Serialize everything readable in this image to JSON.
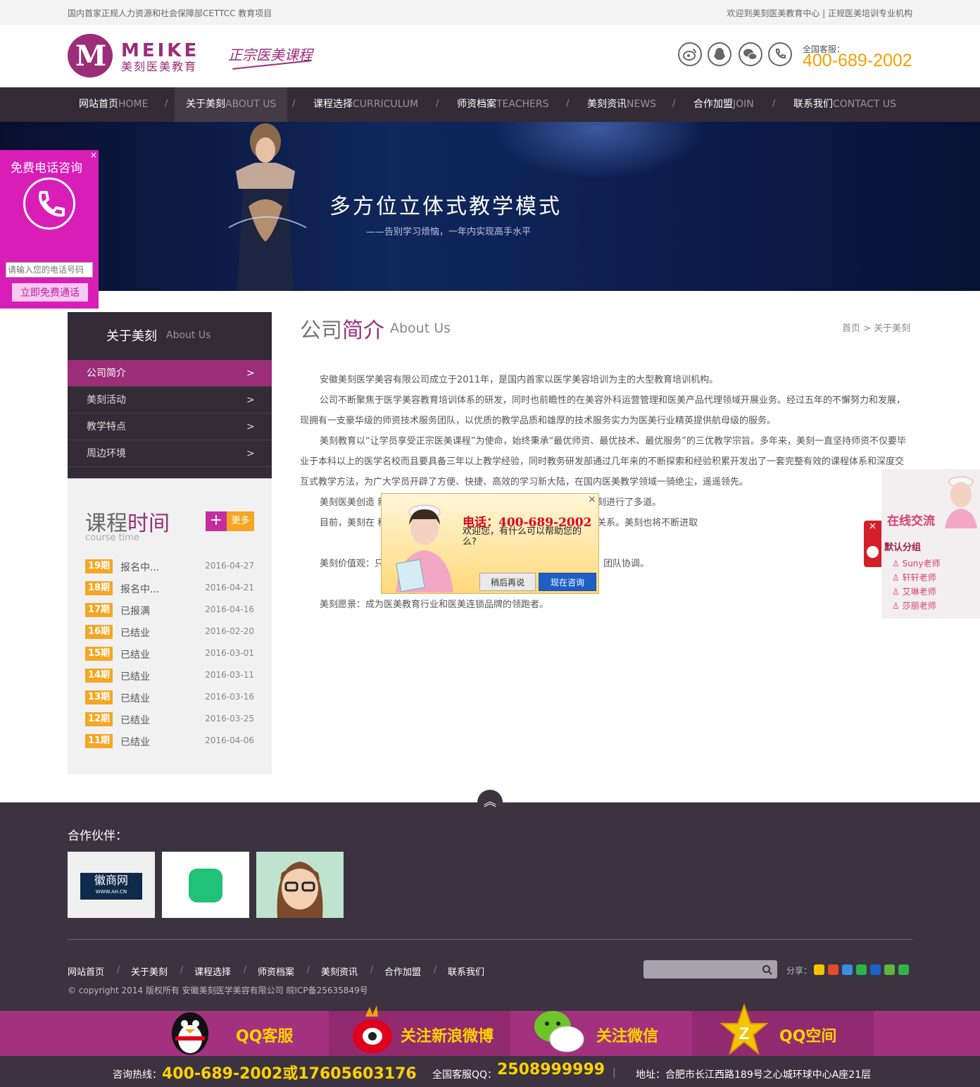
{
  "topbar": {
    "left": "国内首家正规人力资源和社会保障部CETTCC 教育项目",
    "right": "欢迎到美刻医美教育中心 | 正规医美培训专业机构"
  },
  "header": {
    "logo_mark": "M",
    "logo_en": "MEIKE",
    "logo_cn": "美刻医美教育",
    "slogan": "正宗医美课程",
    "service_label": "全国客服：",
    "service_phone": "400-689-2002"
  },
  "nav": [
    {
      "cn": "网站首页",
      "en": "HOME"
    },
    {
      "cn": "关于美刻",
      "en": "ABOUT US"
    },
    {
      "cn": "课程选择",
      "en": "CURRICULUM"
    },
    {
      "cn": "师资档案",
      "en": "TEACHERS"
    },
    {
      "cn": "美刻资讯",
      "en": "NEWS"
    },
    {
      "cn": "合作加盟",
      "en": "JOIN"
    },
    {
      "cn": "联系我们",
      "en": "CONTACT US"
    }
  ],
  "nav_separator": "/",
  "banner": {
    "title": "多方位立体式教学模式",
    "subtitle": "——告别学习烦恼，一年内实现高手水平"
  },
  "float_call": {
    "title": "免费电话咨询",
    "close": "×",
    "placeholder": "请输入您的电话号码",
    "button": "立即免费通话"
  },
  "sidebar": {
    "title": "关于美刻",
    "title_en": "About Us",
    "items": [
      {
        "label": "公司简介",
        "arrow": ">"
      },
      {
        "label": "美刻活动",
        "arrow": ">"
      },
      {
        "label": "教学特点",
        "arrow": ">"
      },
      {
        "label": "周边环境",
        "arrow": ">"
      }
    ],
    "course": {
      "title_a": "课程",
      "title_b": "时间",
      "subtitle": "course time",
      "plus": "+",
      "more": "更多",
      "rows": [
        {
          "term": "19期",
          "status": "报名中...",
          "date": "2016-04-27"
        },
        {
          "term": "18期",
          "status": "报名中...",
          "date": "2016-04-21"
        },
        {
          "term": "17期",
          "status": "已报满",
          "date": "2016-04-16"
        },
        {
          "term": "16期",
          "status": "已结业",
          "date": "2016-02-20"
        },
        {
          "term": "15期",
          "status": "已结业",
          "date": "2016-03-01"
        },
        {
          "term": "14期",
          "status": "已结业",
          "date": "2016-03-11"
        },
        {
          "term": "13期",
          "status": "已结业",
          "date": "2016-03-16"
        },
        {
          "term": "12期",
          "status": "已结业",
          "date": "2016-03-25"
        },
        {
          "term": "11期",
          "status": "已结业",
          "date": "2016-04-06"
        }
      ]
    }
  },
  "main": {
    "title_a": "公司",
    "title_b": "简介",
    "title_en": "About Us",
    "breadcrumb": "首页 > 关于美刻",
    "paragraphs": [
      "安徽美刻医学美容有限公司成立于2011年，是国内首家以医学美容培训为主的大型教育培训机构。",
      "公司不断聚焦于医学美容教育培训体系的研发，同时也前瞻性的在美容外科运营管理和医美产品代理领域开展业务。经过五年的不懈努力和发展，现拥有一支豪华级的师资技术服务团队，以优质的教学品质和雄厚的技术服务实力为医美行业精英提供航母级的服务。",
      "美刻教育以“让学员享受正宗医美课程”为使命，始终秉承“最优师资、最优技术、最优服务”的三优教学宗旨。多年来，美刻一直坚持师资不仅要毕业于本科以上的医学名校而且要具备三年以上教学经验，同时教务研发部通过几年来的不断探索和经验积累开发出了一套完整有效的课程体系和深度交互式教学方法，为广大学员开辟了方便、快捷、高效的学习新大陆，在国内医美教学领域一骑绝尘，遥遥领先。",
      "美刻医美创造                                                              新浪、搜狐、人民网、徽商网等多家知名媒体先后对美刻进行了多道。",
      "目前，美刻在                                                              科医院、二百多家大型美容院建立了长期战略合作伙伴关系。美刻也将不断进取",
      "美刻价值观：只要结果，拒绝理由；积极思考，注重实效；客户满意，团队协调。",
      "美刻愿景：成为医美教育行业和医美连锁品牌的领跑者。"
    ]
  },
  "popup": {
    "phone": "电话：400-689-2002",
    "message": "欢迎您，有什么可以帮助您的么?",
    "close": "×",
    "later": "稍后再说",
    "now": "现在咨询"
  },
  "chat": {
    "title": "在线交流",
    "close": "×",
    "group": "默认分组",
    "agents": [
      "Suny老师",
      "轩轩老师",
      "艾琳老师",
      "莎丽老师"
    ]
  },
  "footer": {
    "top": "︽",
    "partners": "合作伙伴：",
    "partner_logo_text": "徽商网",
    "partner_logo_sub": "WWW.AH.CN",
    "links": [
      "网站首页",
      "关于美刻",
      "课程选择",
      "师资档案",
      "美刻资讯",
      "合作加盟",
      "联系我们"
    ],
    "link_sep": "/",
    "share": "分享：",
    "copyright": "© copyright 2014 版权所有 安徽美刻医学美容有限公司 皖ICP备25635849号"
  },
  "bottom_bar": [
    "QQ客服",
    "关注新浪微博",
    "关注微信",
    "QQ空间"
  ],
  "hotline": {
    "label1": "咨询热线：",
    "value1": "400-689-2002或17605603176",
    "label2": "全国客服QQ：",
    "value2": "2508999999",
    "label3": "地址：合肥市长江西路189号之心城环球中心A座21层",
    "sep": "|"
  },
  "colors": {
    "brand": "#9b2d79",
    "accent": "#f5a623",
    "nav_bg": "#332b35",
    "float_pink": "#d91eb8"
  }
}
